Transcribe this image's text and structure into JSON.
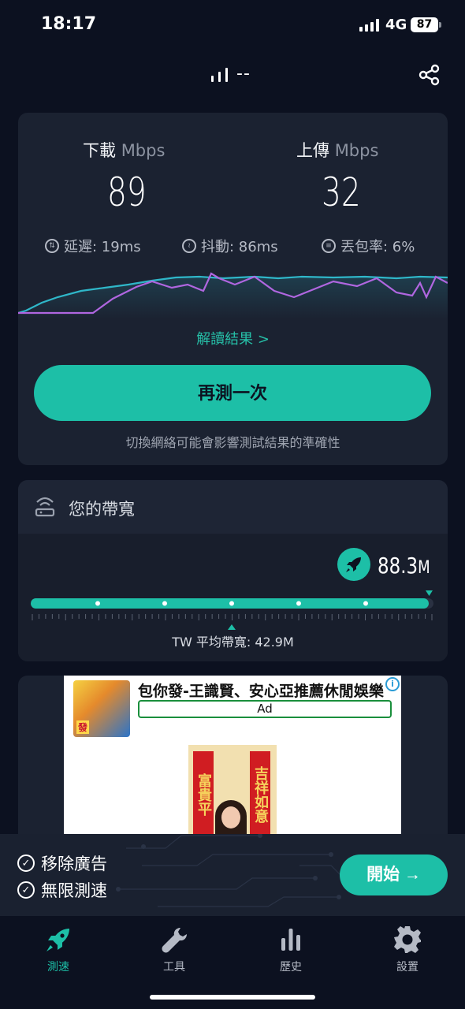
{
  "status_bar": {
    "time": "18:17",
    "network": "4G",
    "battery": "87"
  },
  "header": {
    "server_name": "--"
  },
  "result": {
    "download": {
      "label": "下載",
      "unit": "Mbps",
      "value": "89"
    },
    "upload": {
      "label": "上傳",
      "unit": "Mbps",
      "value": "32"
    },
    "latency": "延遲: 19ms",
    "jitter": "抖動: 86ms",
    "packet_loss": "丟包率: 6%",
    "interpret_link": "解讀結果 >",
    "retest_button": "再測一次",
    "note": "切換網絡可能會影響測試結果的準確性"
  },
  "bandwidth": {
    "title": "您的帶寬",
    "value": "88.3",
    "value_unit": "M",
    "average_label": "TW 平均帶寬: 42.9M"
  },
  "ad": {
    "title": "包你發-王識賢、安心亞推薦休閒娛樂",
    "label": "Ad",
    "thumb_text": "發",
    "couplet_left": "富貴平",
    "couplet_right": "吉祥如意"
  },
  "promo": {
    "item1": "移除廣告",
    "item2": "無限測速",
    "start_button": "開始 →"
  },
  "tabs": [
    {
      "label": "測速"
    },
    {
      "label": "工具"
    },
    {
      "label": "歷史"
    },
    {
      "label": "設置"
    }
  ],
  "colors": {
    "accent": "#1dbfa7",
    "background": "#0c1120",
    "card": "#1b2231",
    "download_line": "#2fb7c9",
    "upload_line": "#b066e0"
  }
}
